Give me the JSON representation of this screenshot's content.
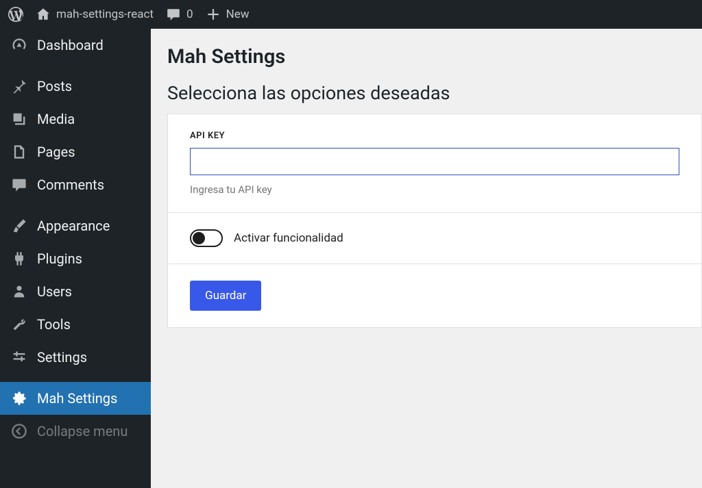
{
  "adminbar": {
    "site_title": "mah-settings-react",
    "comments_count": "0",
    "new_label": "New"
  },
  "sidebar": {
    "dashboard": "Dashboard",
    "posts": "Posts",
    "media": "Media",
    "pages": "Pages",
    "comments": "Comments",
    "appearance": "Appearance",
    "plugins": "Plugins",
    "users": "Users",
    "tools": "Tools",
    "settings": "Settings",
    "mah_settings": "Mah Settings",
    "collapse": "Collapse menu"
  },
  "page": {
    "title": "Mah Settings",
    "subtitle": "Selecciona las opciones deseadas",
    "api_key_label": "API KEY",
    "api_key_value": "",
    "api_key_help": "Ingresa tu API key",
    "toggle_label": "Activar funcionalidad",
    "save_label": "Guardar"
  }
}
